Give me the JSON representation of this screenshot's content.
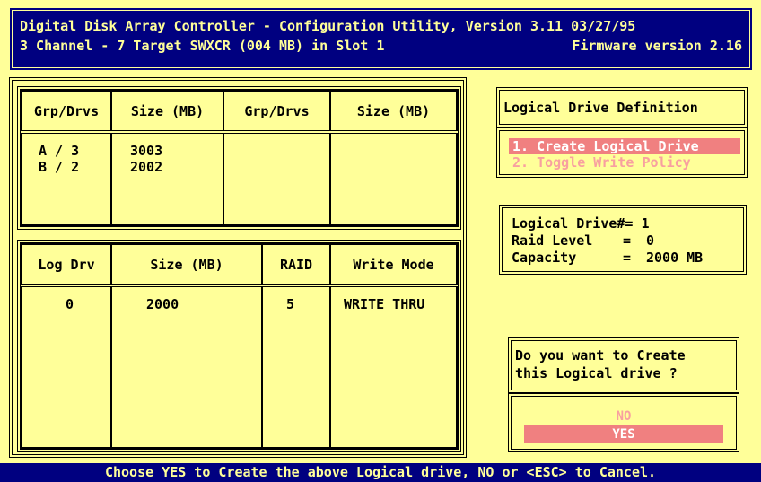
{
  "header": {
    "title": "Digital Disk Array Controller - Configuration Utility, Version 3.11 03/27/95",
    "channel_info": "3 Channel - 7 Target  SWXCR (004 MB) in Slot 1",
    "firmware": "Firmware version 2.16"
  },
  "group_table": {
    "headers": [
      "Grp/Drvs",
      "Size (MB)",
      "Grp/Drvs",
      "Size (MB)"
    ],
    "col1": [
      "A / 3",
      "B / 2"
    ],
    "col2": [
      "3003",
      "2002"
    ],
    "col3": [],
    "col4": []
  },
  "logical_table": {
    "headers": [
      "Log Drv",
      "Size (MB)",
      "RAID",
      "Write Mode"
    ],
    "rows": [
      {
        "log_drv": "0",
        "size": "2000",
        "raid": "5",
        "write_mode": "WRITE THRU"
      }
    ]
  },
  "menu": {
    "title": "Logical Drive Definition",
    "items": [
      "1. Create Logical Drive",
      "2. Toggle Write Policy"
    ]
  },
  "info": {
    "drive_label": "Logical Drive#=",
    "drive_value": "1",
    "raid_label": "Raid Level",
    "raid_value": "0",
    "capacity_label": "Capacity",
    "capacity_value": "2000 MB"
  },
  "dialog": {
    "question_line1": "Do you want to Create",
    "question_line2": "this Logical drive ?",
    "no_label": "NO",
    "yes_label": "YES"
  },
  "footer": {
    "text": "Choose YES to Create the above Logical drive, NO or <ESC> to Cancel."
  }
}
